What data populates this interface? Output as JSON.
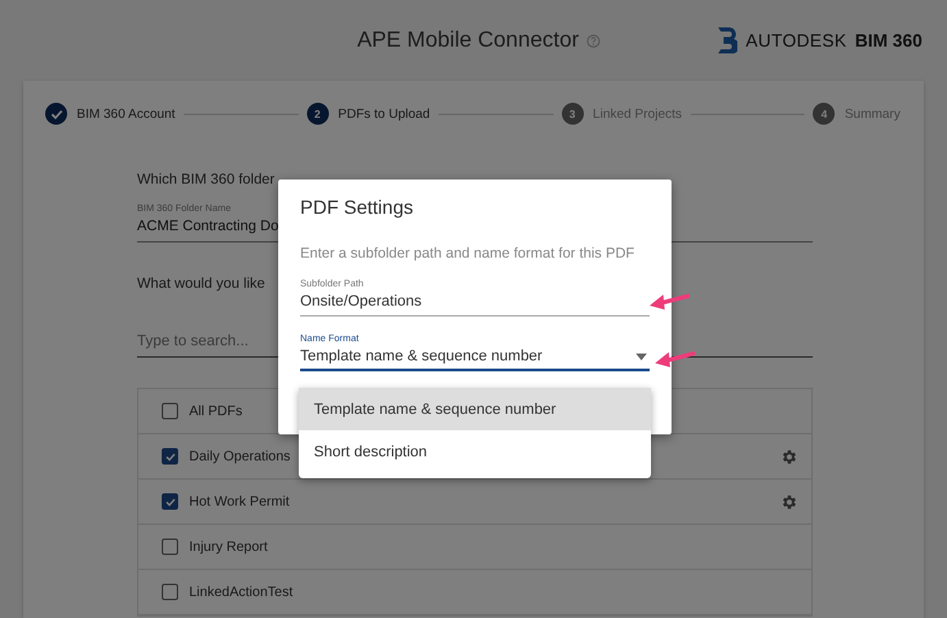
{
  "header": {
    "title": "APE Mobile Connector",
    "logo": {
      "brand": "AUTODESK",
      "product": "BIM 360"
    }
  },
  "steps": [
    {
      "label": "BIM 360 Account",
      "done": true,
      "active": true
    },
    {
      "number": "2",
      "label": "PDFs to Upload",
      "done": false,
      "active": true
    },
    {
      "number": "3",
      "label": "Linked Projects",
      "done": false,
      "active": false
    },
    {
      "number": "4",
      "label": "Summary",
      "done": false,
      "active": false
    }
  ],
  "form": {
    "folder_question": "Which BIM 360 folder",
    "folder_field": {
      "label": "BIM 360 Folder Name",
      "value": "ACME Contracting Do"
    },
    "pdf_question": "What would you like",
    "search": {
      "placeholder": "Type to search..."
    },
    "pdfs": [
      {
        "label": "All PDFs",
        "checked": false,
        "settings": false
      },
      {
        "label": "Daily Operations",
        "checked": true,
        "settings": true
      },
      {
        "label": "Hot Work Permit",
        "checked": true,
        "settings": true
      },
      {
        "label": "Injury Report",
        "checked": false,
        "settings": false
      },
      {
        "label": "LinkedActionTest",
        "checked": false,
        "settings": false
      }
    ]
  },
  "dialog": {
    "title": "PDF Settings",
    "description": "Enter a subfolder path and name format for this PDF",
    "subfolder_field": {
      "label": "Subfolder Path",
      "value": "Onsite/Operations"
    },
    "name_format": {
      "label": "Name Format",
      "value": "Template name & sequence number",
      "expanded": true
    },
    "menu": [
      {
        "label": "Template name & sequence number",
        "selected": true
      },
      {
        "label": "Short description",
        "selected": false
      }
    ]
  }
}
